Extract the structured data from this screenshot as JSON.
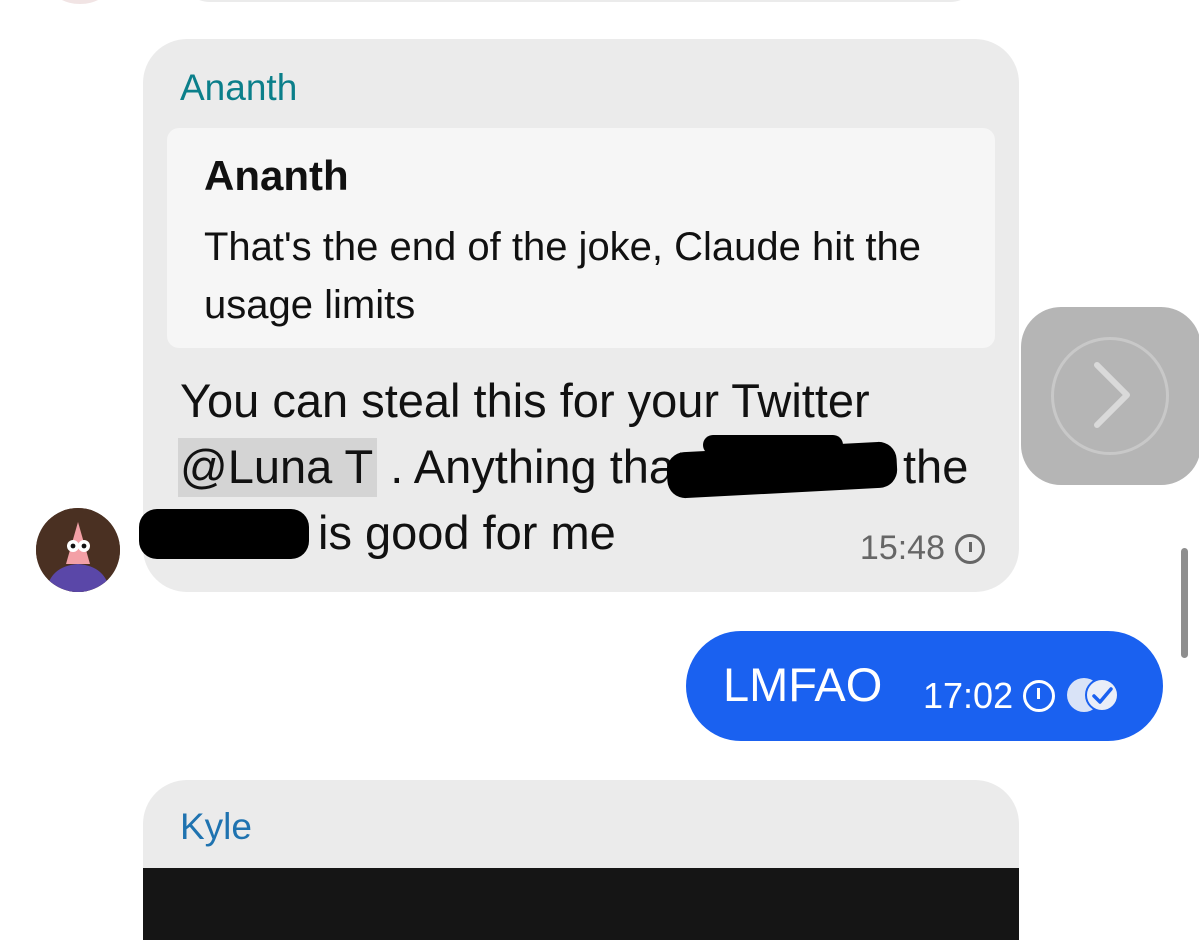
{
  "incoming": {
    "sender": "Ananth",
    "quote": {
      "author": "Ananth",
      "text": "That's the end of the joke, Claude hit the usage limits"
    },
    "line1": "You can steal this for your Twitter",
    "mention": "@Luna T",
    "line2_rest": " . Anything that",
    "line2_tail": "the",
    "line3": "is good for me",
    "time": "15:48",
    "status_icon": "clock-icon"
  },
  "outgoing": {
    "text": "LMFAO",
    "time": "17:02",
    "status_icon": "clock-icon",
    "read_icon": "double-check-icon"
  },
  "next_message": {
    "sender": "Kyle"
  },
  "colors": {
    "incoming_bubble": "#ebebeb",
    "outgoing_bubble": "#1a61f0",
    "sender_ananth": "#0b7f8a",
    "sender_kyle": "#1f73b0"
  }
}
